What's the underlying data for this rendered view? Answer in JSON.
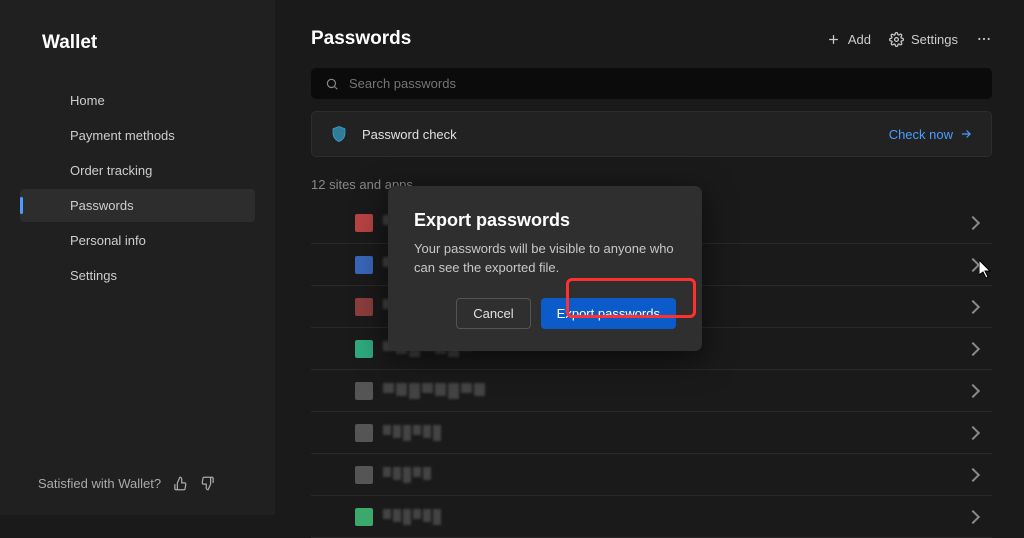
{
  "sidebar": {
    "title": "Wallet",
    "items": [
      {
        "label": "Home"
      },
      {
        "label": "Payment methods"
      },
      {
        "label": "Order tracking"
      },
      {
        "label": "Passwords"
      },
      {
        "label": "Personal info"
      },
      {
        "label": "Settings"
      }
    ],
    "footer": "Satisfied with Wallet?"
  },
  "header": {
    "title": "Passwords",
    "add": "Add",
    "settings": "Settings"
  },
  "search": {
    "placeholder": "Search passwords"
  },
  "check": {
    "label": "Password check",
    "link": "Check now"
  },
  "section_label": "12 sites and apps",
  "password_rows": [
    {
      "color": "#b84343",
      "w": 5
    },
    {
      "color": "#3a66b8",
      "w": 4
    },
    {
      "color": "#8b3d3d",
      "w": 6
    },
    {
      "color": "#2ea97d",
      "w": 7
    },
    {
      "color": "#555555",
      "w": 8
    },
    {
      "color": "#555555",
      "w": 6
    },
    {
      "color": "#555555",
      "w": 5
    },
    {
      "color": "#3aa96b",
      "w": 6
    }
  ],
  "modal": {
    "title": "Export passwords",
    "body": "Your passwords will be visible to anyone who can see the exported file.",
    "cancel": "Cancel",
    "confirm": "Export passwords"
  }
}
